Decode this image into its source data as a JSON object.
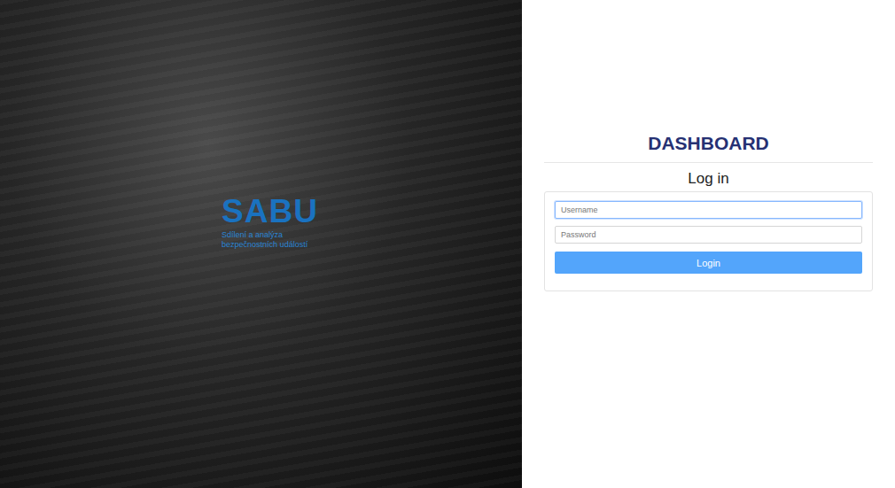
{
  "logo": {
    "title": "SABU",
    "subtitle": [
      "Sdílení a analýza",
      "bezpečnostních událostí"
    ]
  },
  "header": {
    "title": "DASHBOARD"
  },
  "form": {
    "title": "Log in",
    "fields": [
      {
        "name": "username",
        "placeholder": "Username",
        "type": "text",
        "focused": true
      },
      {
        "name": "password",
        "placeholder": "Password",
        "type": "password",
        "focused": false
      }
    ],
    "button": "Login"
  }
}
